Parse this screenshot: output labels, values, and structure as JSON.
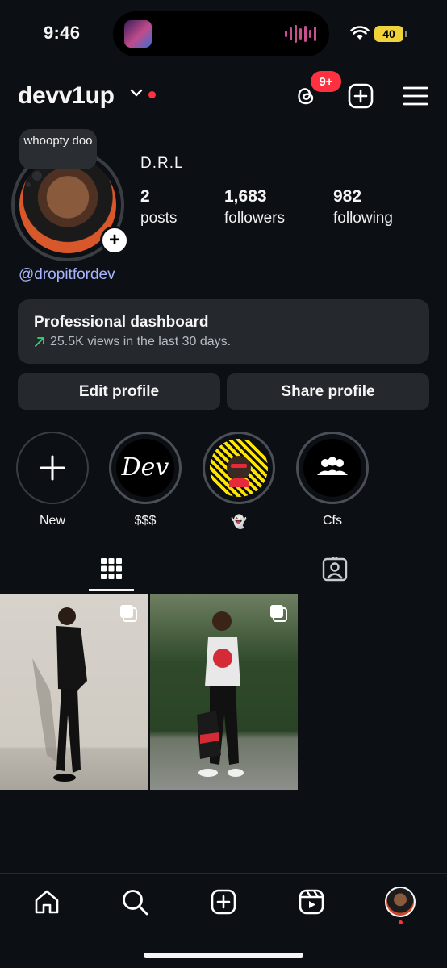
{
  "status_bar": {
    "time": "9:46",
    "battery": "40"
  },
  "header": {
    "username": "devv1up",
    "notifications_badge": "9+"
  },
  "profile": {
    "note": "whoopty doo",
    "full_name": "D.R.L",
    "stats": [
      {
        "value": "2",
        "label": "posts"
      },
      {
        "value": "1,683",
        "label": "followers"
      },
      {
        "value": "982",
        "label": "following"
      }
    ],
    "link": "@dropitfordev"
  },
  "dashboard": {
    "title": "Professional dashboard",
    "subtitle": "25.5K views in the last 30 days."
  },
  "buttons": {
    "edit": "Edit profile",
    "share": "Share profile"
  },
  "highlights": [
    {
      "label": "New"
    },
    {
      "label": "$$$",
      "cover_text": "Dev"
    },
    {
      "label": "👻"
    },
    {
      "label": "Cfs"
    }
  ],
  "tabs": {
    "active": "posts-grid",
    "items": [
      "posts-grid",
      "tagged"
    ]
  },
  "posts": [
    {
      "icon": "multi-photo-icon"
    },
    {
      "icon": "multi-photo-icon"
    }
  ],
  "bottom_nav": [
    "home-icon",
    "search-icon",
    "create-icon",
    "reels-icon",
    "profile-avatar"
  ],
  "colors": {
    "background": "#0c1014",
    "accent": "#ff3040",
    "link": "#a8b4ff",
    "card": "#25292e"
  }
}
